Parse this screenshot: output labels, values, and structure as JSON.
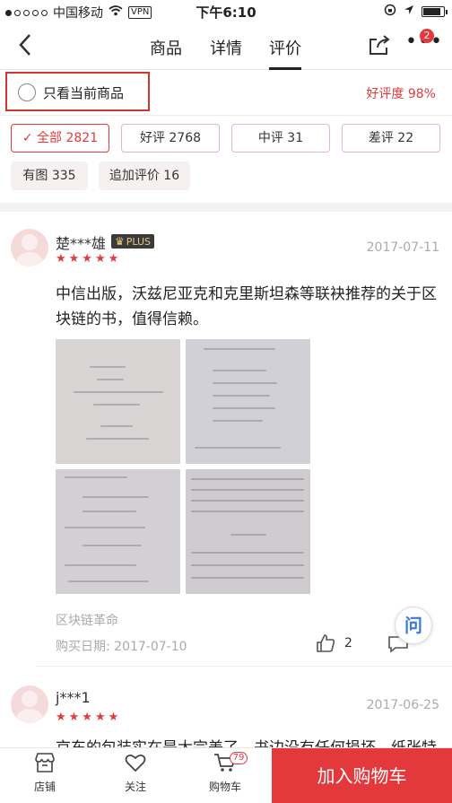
{
  "status_bar": {
    "carrier": "中国移动",
    "vpn": "VPN",
    "time": "下午6:10"
  },
  "nav": {
    "tabs": [
      "商品",
      "详情",
      "评价"
    ],
    "active_tab": "评价",
    "more_badge": "2"
  },
  "filter": {
    "only_current": "只看当前商品",
    "good_rate": "好评度 98%"
  },
  "chips": [
    {
      "label": "✓ 全部 2821",
      "active": true
    },
    {
      "label": "好评 2768"
    },
    {
      "label": "中评 31"
    },
    {
      "label": "差评 22"
    },
    {
      "label": "有图 335"
    },
    {
      "label": "追加评价 16"
    }
  ],
  "reviews": [
    {
      "user": "楚***雄",
      "plus_label": "PLUS",
      "date": "2017-07-11",
      "rating": 5,
      "content": "中信出版，沃兹尼亚克和克里斯坦森等联袂推荐的关于区块链的书，值得信赖。",
      "product": "区块链革命",
      "purchase_date": "购买日期: 2017-07-10",
      "likes": "2"
    },
    {
      "user": "j***1",
      "date": "2017-06-25",
      "rating": 5,
      "content": "京东的包装实在是太完美了，书边没有任何损坏，纸张特"
    }
  ],
  "float_button": "问",
  "bottom_bar": {
    "store": "店铺",
    "follow": "关注",
    "cart": "购物车",
    "cart_count": "79",
    "add_cart": "加入购物车"
  },
  "colors": {
    "accent": "#e4393c"
  }
}
